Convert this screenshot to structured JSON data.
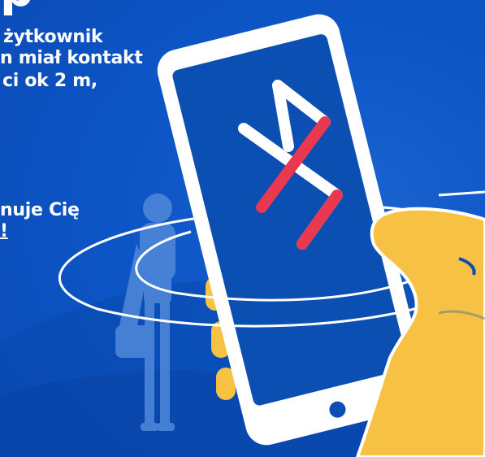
{
  "headline": {
    "fragment": "р"
  },
  "text": {
    "line1": "żytkownik",
    "line2": "n miał kontakt",
    "line3": "ci ok 2 m,",
    "line4": "nuje Cię",
    "line5": "!"
  },
  "illustration": {
    "phone_screen_icon": "bluetooth-icon",
    "colors": {
      "background": "#0b52c2",
      "phone_body": "#ffffff",
      "phone_screen": "#0c4fb3",
      "bluetooth_red": "#e9384f",
      "hand_yellow": "#f7c244",
      "silhouette": "#4c86d8"
    }
  }
}
